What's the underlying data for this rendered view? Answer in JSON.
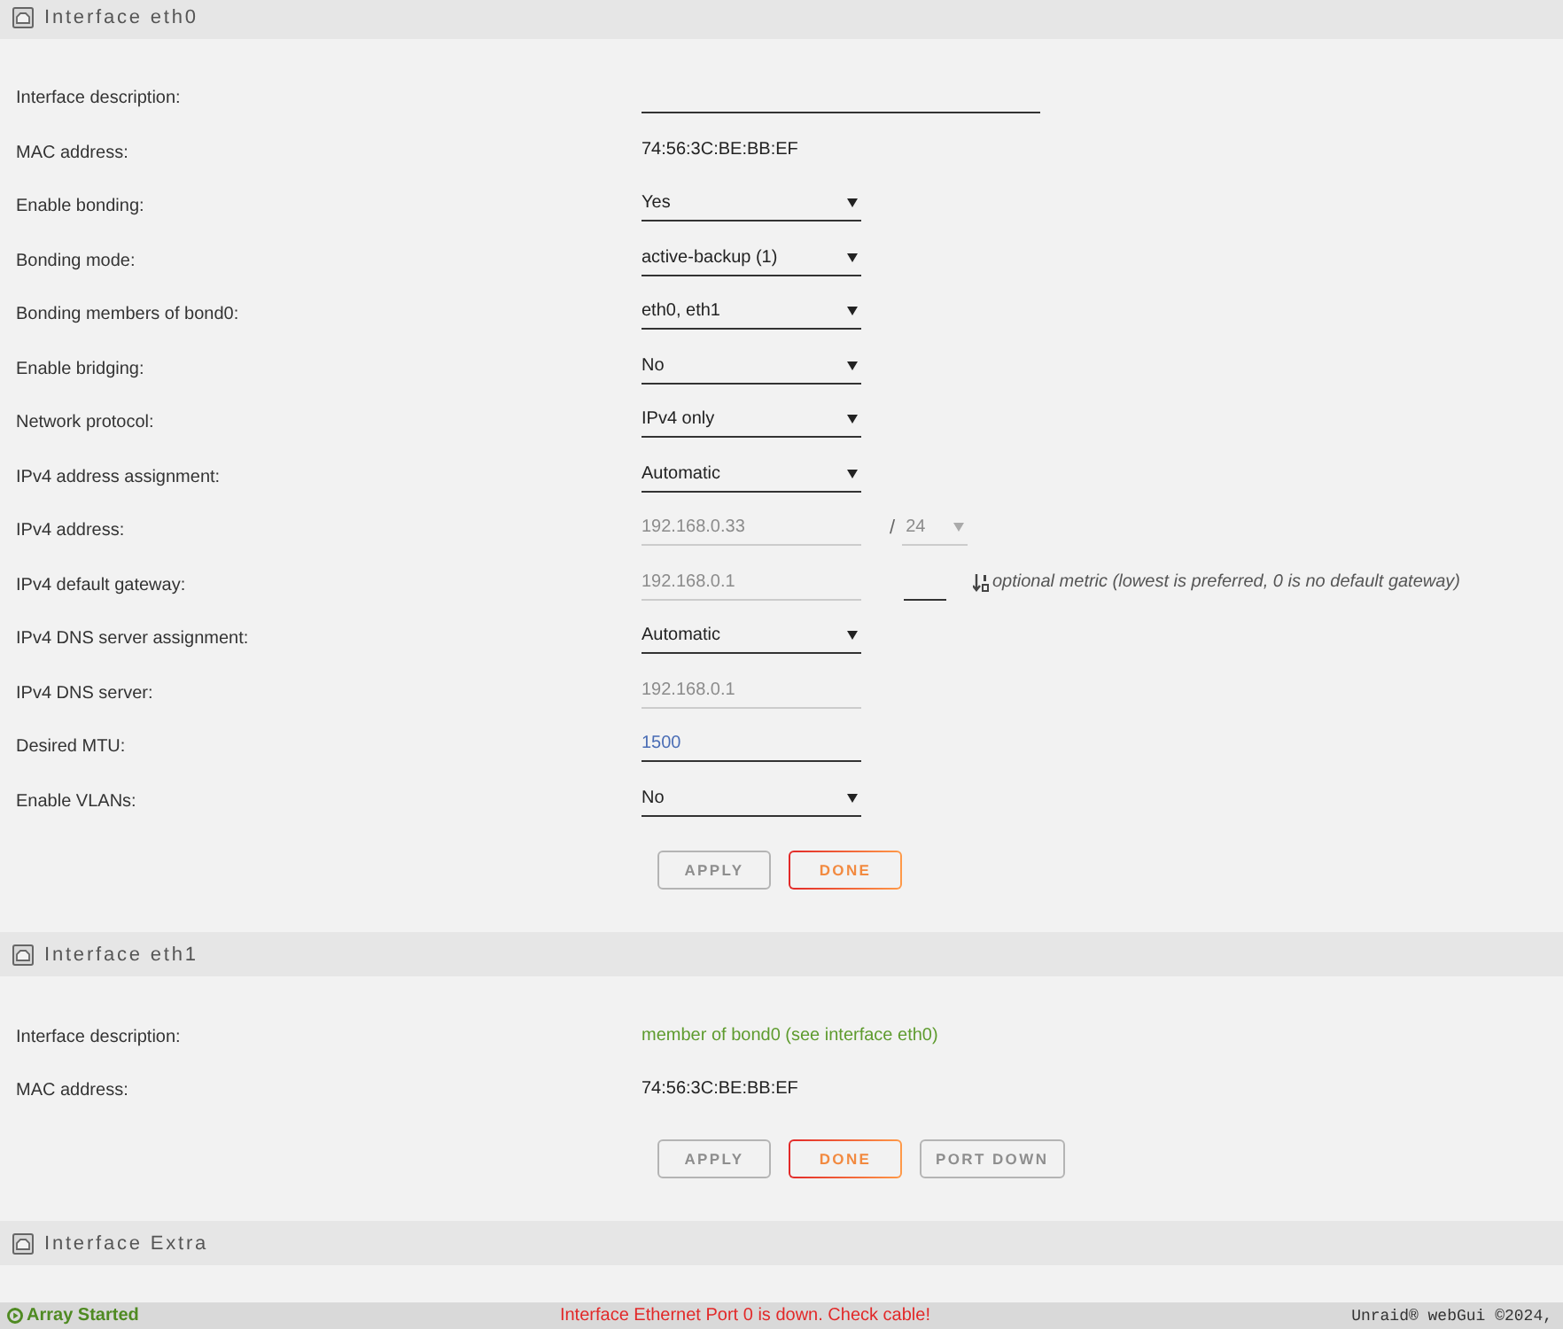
{
  "sections": [
    {
      "title": "Interface eth0",
      "rows": [
        {
          "label": "Interface description:",
          "kind": "wideinput",
          "disabled": false
        },
        {
          "label": "MAC address:",
          "kind": "text",
          "value": "74:56:3C:BE:BB:EF"
        },
        {
          "label": "Enable bonding:",
          "kind": "select",
          "value": "Yes",
          "disabled": false
        },
        {
          "label": "Bonding mode:",
          "kind": "select",
          "value": "active-backup (1)",
          "disabled": false
        },
        {
          "label": "Bonding members of bond0:",
          "kind": "select",
          "value": "eth0, eth1",
          "disabled": false
        },
        {
          "label": "Enable bridging:",
          "kind": "select",
          "value": "No",
          "disabled": false
        },
        {
          "label": "Network protocol:",
          "kind": "select",
          "value": "IPv4 only",
          "disabled": false
        },
        {
          "label": "IPv4 address assignment:",
          "kind": "select",
          "value": "Automatic",
          "disabled": false
        },
        {
          "label": "IPv4 address:",
          "kind": "input",
          "value": "192.168.0.33",
          "disabled": true,
          "separator": "/",
          "netmask": {
            "value": "24",
            "disabled": true
          }
        },
        {
          "label": "IPv4 default gateway:",
          "kind": "input",
          "value": "192.168.0.1",
          "disabled": true,
          "metric": {
            "disabled": false
          },
          "note": "optional metric (lowest is preferred, 0 is no default gateway)"
        },
        {
          "label": "IPv4 DNS server assignment:",
          "kind": "select",
          "value": "Automatic",
          "disabled": false
        },
        {
          "label": "IPv4 DNS server:",
          "kind": "input",
          "value": "192.168.0.1",
          "disabled": true
        },
        {
          "label": "Desired MTU:",
          "kind": "input",
          "value": "1500",
          "disabled": false
        },
        {
          "label": "Enable VLANs:",
          "kind": "select",
          "value": "No",
          "disabled": false
        }
      ],
      "buttons": [
        {
          "label": "APPLY",
          "disabled": true
        },
        {
          "label": "DONE",
          "disabled": false
        }
      ]
    },
    {
      "title": "Interface eth1",
      "rows": [
        {
          "label": "Interface description:",
          "kind": "info",
          "value": "member of bond0 (see interface eth0)"
        },
        {
          "label": "MAC address:",
          "kind": "text",
          "value": "74:56:3C:BE:BB:EF"
        }
      ],
      "buttons": [
        {
          "label": "APPLY",
          "disabled": true
        },
        {
          "label": "DONE",
          "disabled": false
        },
        {
          "label": "PORT DOWN",
          "disabled": true
        }
      ]
    },
    {
      "title": "Interface Extra"
    }
  ],
  "status_bar": {
    "array_status": "Array Started",
    "alert": "Interface Ethernet Port 0 is down. Check cable!",
    "credit": "Unraid® webGui ©2024,"
  }
}
